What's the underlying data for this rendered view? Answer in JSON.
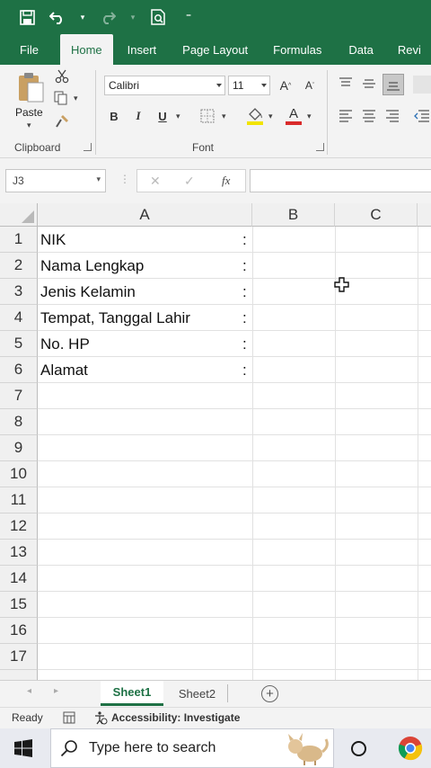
{
  "tabs": [
    "File",
    "Home",
    "Insert",
    "Page Layout",
    "Formulas",
    "Data",
    "Revi"
  ],
  "ribbon": {
    "paste_label": "Paste",
    "font_name": "Calibri",
    "font_size": "11",
    "clipboard_label": "Clipboard",
    "font_label": "Font",
    "bold": "B",
    "italic": "I",
    "underline": "U",
    "grow_font": "A",
    "shrink_font": "A",
    "font_color": "A"
  },
  "formula_bar": {
    "name_box": "J3",
    "fx": "fx",
    "cancel": "✕",
    "enter": "✓",
    "formula": ""
  },
  "columns": [
    "A",
    "B",
    "C"
  ],
  "rows": [
    "1",
    "2",
    "3",
    "4",
    "5",
    "6",
    "7",
    "8",
    "9",
    "10",
    "11",
    "12",
    "13",
    "14",
    "15",
    "16",
    "17"
  ],
  "cells": [
    {
      "label": "NIK",
      "colon": ":"
    },
    {
      "label": "Nama Lengkap",
      "colon": ":"
    },
    {
      "label": "Jenis Kelamin",
      "colon": ":"
    },
    {
      "label": "Tempat, Tanggal Lahir",
      "colon": ":"
    },
    {
      "label": "No. HP",
      "colon": ":"
    },
    {
      "label": "Alamat",
      "colon": ":"
    }
  ],
  "sheets": {
    "active": "Sheet1",
    "other": "Sheet2",
    "add": "+"
  },
  "status": {
    "ready": "Ready",
    "accessibility": "Accessibility: Investigate"
  },
  "taskbar": {
    "search_placeholder": "Type here to search"
  },
  "colors": {
    "accent": "#1e7145",
    "ribbon_bg": "#f3f3f3",
    "font_color_bar": "#d92b2b"
  }
}
